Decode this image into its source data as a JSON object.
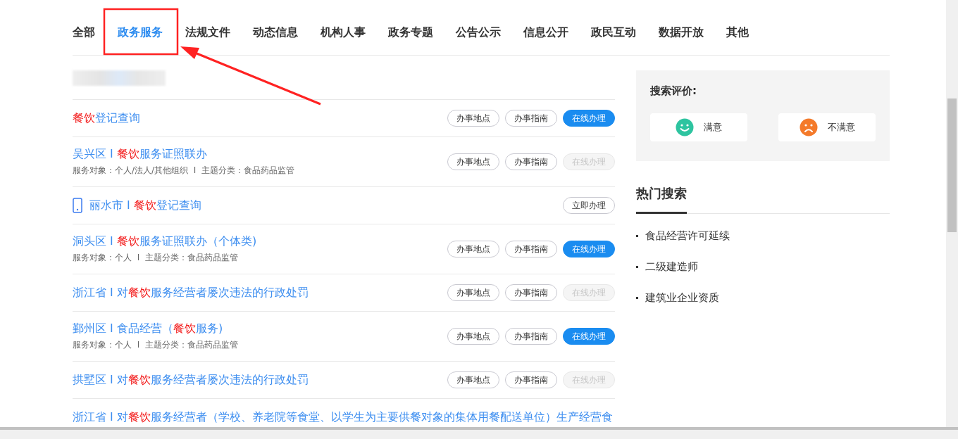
{
  "tabs": [
    {
      "label": "全部",
      "selected": false
    },
    {
      "label": "政务服务",
      "selected": true
    },
    {
      "label": "法规文件",
      "selected": false
    },
    {
      "label": "动态信息",
      "selected": false
    },
    {
      "label": "机构人事",
      "selected": false
    },
    {
      "label": "政务专题",
      "selected": false
    },
    {
      "label": "公告公示",
      "selected": false
    },
    {
      "label": "信息公开",
      "selected": false
    },
    {
      "label": "政民互动",
      "selected": false
    },
    {
      "label": "数据开放",
      "selected": false
    },
    {
      "label": "其他",
      "selected": false
    }
  ],
  "results": [
    {
      "mobile": false,
      "title": [
        {
          "text": "餐饮",
          "highlight": true
        },
        {
          "text": "登记查询",
          "highlight": false
        }
      ],
      "buttons": [
        {
          "label": "办事地点",
          "kind": "outline",
          "disabled": false
        },
        {
          "label": "办事指南",
          "kind": "outline",
          "disabled": false
        },
        {
          "label": "在线办理",
          "kind": "primary",
          "disabled": false
        }
      ]
    },
    {
      "mobile": false,
      "title": [
        {
          "text": "吴兴区 I ",
          "highlight": false
        },
        {
          "text": "餐饮",
          "highlight": true
        },
        {
          "text": "服务证照联办",
          "highlight": false
        }
      ],
      "meta": "服务对象：个人/法人/其他组织  I  主题分类：食品药品监管",
      "buttons": [
        {
          "label": "办事地点",
          "kind": "outline",
          "disabled": false
        },
        {
          "label": "办事指南",
          "kind": "outline",
          "disabled": false
        },
        {
          "label": "在线办理",
          "kind": "primary",
          "disabled": true
        }
      ]
    },
    {
      "mobile": true,
      "title": [
        {
          "text": "丽水市 I ",
          "highlight": false
        },
        {
          "text": "餐饮",
          "highlight": true
        },
        {
          "text": "登记查询",
          "highlight": false
        }
      ],
      "buttons": [
        {
          "label": "立即办理",
          "kind": "outline",
          "disabled": false
        }
      ]
    },
    {
      "mobile": false,
      "title": [
        {
          "text": "洞头区 I ",
          "highlight": false
        },
        {
          "text": "餐饮",
          "highlight": true
        },
        {
          "text": "服务证照联办（个体类)",
          "highlight": false
        }
      ],
      "meta": "服务对象：个人  I  主题分类：食品药品监管",
      "buttons": [
        {
          "label": "办事地点",
          "kind": "outline",
          "disabled": false
        },
        {
          "label": "办事指南",
          "kind": "outline",
          "disabled": false
        },
        {
          "label": "在线办理",
          "kind": "primary",
          "disabled": false
        }
      ]
    },
    {
      "mobile": false,
      "title": [
        {
          "text": "浙江省 I 对",
          "highlight": false
        },
        {
          "text": "餐饮",
          "highlight": true
        },
        {
          "text": "服务经营者屡次违法的行政处罚",
          "highlight": false
        }
      ],
      "buttons": [
        {
          "label": "办事地点",
          "kind": "outline",
          "disabled": false
        },
        {
          "label": "办事指南",
          "kind": "outline",
          "disabled": false
        },
        {
          "label": "在线办理",
          "kind": "primary",
          "disabled": true
        }
      ]
    },
    {
      "mobile": false,
      "title": [
        {
          "text": "鄞州区 I 食品经营（",
          "highlight": false
        },
        {
          "text": "餐饮",
          "highlight": true
        },
        {
          "text": "服务)",
          "highlight": false
        }
      ],
      "meta": "服务对象：个人  I  主题分类：食品药品监管",
      "buttons": [
        {
          "label": "办事地点",
          "kind": "outline",
          "disabled": false
        },
        {
          "label": "办事指南",
          "kind": "outline",
          "disabled": false
        },
        {
          "label": "在线办理",
          "kind": "primary",
          "disabled": false
        }
      ]
    },
    {
      "mobile": false,
      "title": [
        {
          "text": "拱墅区 I 对",
          "highlight": false
        },
        {
          "text": "餐饮",
          "highlight": true
        },
        {
          "text": "服务经营者屡次违法的行政处罚",
          "highlight": false
        }
      ],
      "buttons": [
        {
          "label": "办事地点",
          "kind": "outline",
          "disabled": false
        },
        {
          "label": "办事指南",
          "kind": "outline",
          "disabled": false
        },
        {
          "label": "在线办理",
          "kind": "primary",
          "disabled": true
        }
      ]
    },
    {
      "mobile": false,
      "title": [
        {
          "text": "浙江省 I 对",
          "highlight": false
        },
        {
          "text": "餐饮",
          "highlight": true
        },
        {
          "text": "服务经营者（学校、养老院等食堂、以学生为主要供餐对象的集体用餐配送单位）生产经营食",
          "highlight": false
        }
      ]
    }
  ],
  "rating": {
    "title": "搜索评价:",
    "options": [
      {
        "label": "满意",
        "kind": "happy"
      },
      {
        "label": "不满意",
        "kind": "sad"
      }
    ]
  },
  "hot": {
    "title": "热门搜索",
    "items": [
      "食品经营许可延续",
      "二级建造师",
      "建筑业企业资质"
    ]
  }
}
